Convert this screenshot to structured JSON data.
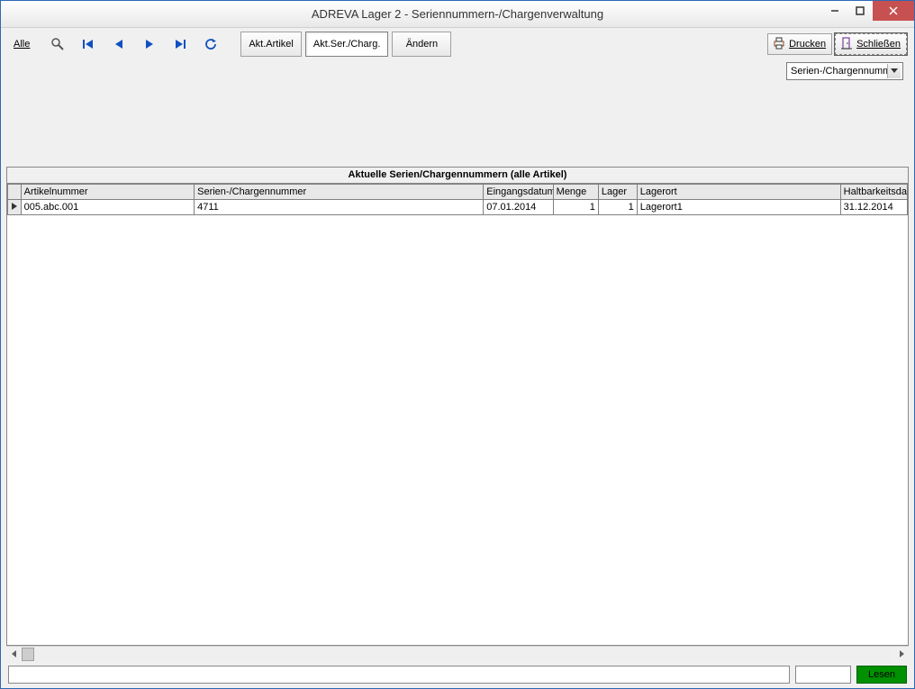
{
  "window": {
    "title": "ADREVA Lager 2 - Seriennummern-/Chargenverwaltung"
  },
  "toolbar": {
    "alle": "Alle",
    "akt_artikel": "Akt.Artikel",
    "akt_ser_charg": "Akt.Ser./Charg.",
    "aendern": "Ändern",
    "drucken": "Drucken",
    "schliessen": "Schließen"
  },
  "dropdown": {
    "selected": "Serien-/Chargennummern"
  },
  "table": {
    "title": "Aktuelle Serien/Chargennummern (alle Artikel)",
    "headers": {
      "artikelnummer": "Artikelnummer",
      "charge": "Serien-/Chargennummer",
      "eingangsdatum": "Eingangsdatum",
      "menge": "Menge",
      "lager": "Lager",
      "lagerort": "Lagerort",
      "haltbarkeit": "Haltbarkeitsdatum"
    },
    "rows": [
      {
        "artikelnummer": "005.abc.001",
        "charge": "4711",
        "eingangsdatum": "07.01.2014",
        "menge": "1",
        "lager": "1",
        "lagerort": "Lagerort1",
        "haltbarkeit": "31.12.2014"
      }
    ]
  },
  "footer": {
    "lesen": "Lesen"
  }
}
